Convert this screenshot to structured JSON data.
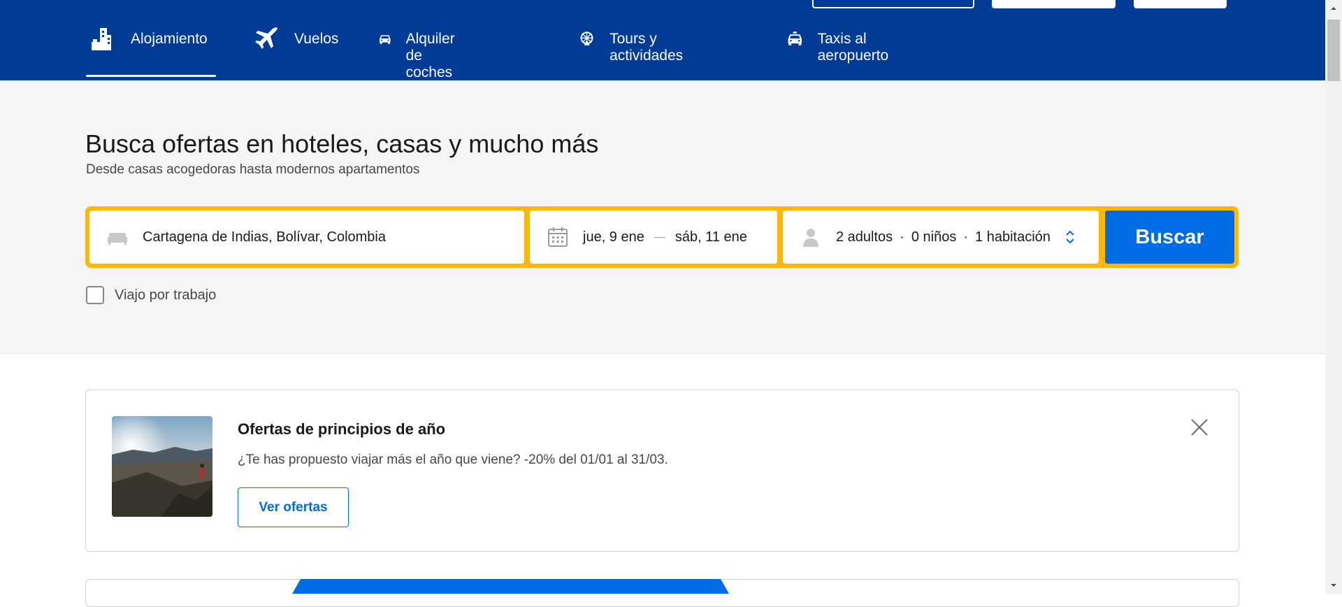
{
  "nav": {
    "items": [
      {
        "label": "Alojamiento",
        "icon": "bed-building-icon",
        "active": true
      },
      {
        "label": "Vuelos",
        "icon": "plane-icon",
        "active": false
      },
      {
        "label": "Alquiler de coches",
        "icon": "car-icon",
        "active": false
      },
      {
        "label": "Tours y actividades",
        "icon": "ferris-wheel-icon",
        "active": false
      },
      {
        "label": "Taxis al aeropuerto",
        "icon": "taxi-icon",
        "active": false
      }
    ]
  },
  "hero": {
    "title": "Busca ofertas en hoteles, casas y mucho más",
    "subtitle": "Desde casas acogedoras hasta modernos apartamentos"
  },
  "search": {
    "destination": "Cartagena de Indias, Bolívar, Colombia",
    "checkin": "jue, 9 ene",
    "checkout": "sáb, 11 ene",
    "adults": "2 adultos",
    "children": "0 niños",
    "rooms": "1 habitación",
    "separator": "·",
    "button_label": "Buscar",
    "work_trip_label": "Viajo por trabajo",
    "work_trip_checked": false
  },
  "promo": {
    "title": "Ofertas de principios de año",
    "description": "¿Te has propuesto viajar más el año que viene? -20% del 01/01 al 31/03.",
    "button_label": "Ver ofertas"
  },
  "colors": {
    "brand": "#003b95",
    "accent": "#006ce4",
    "search_border": "#ffb700"
  }
}
